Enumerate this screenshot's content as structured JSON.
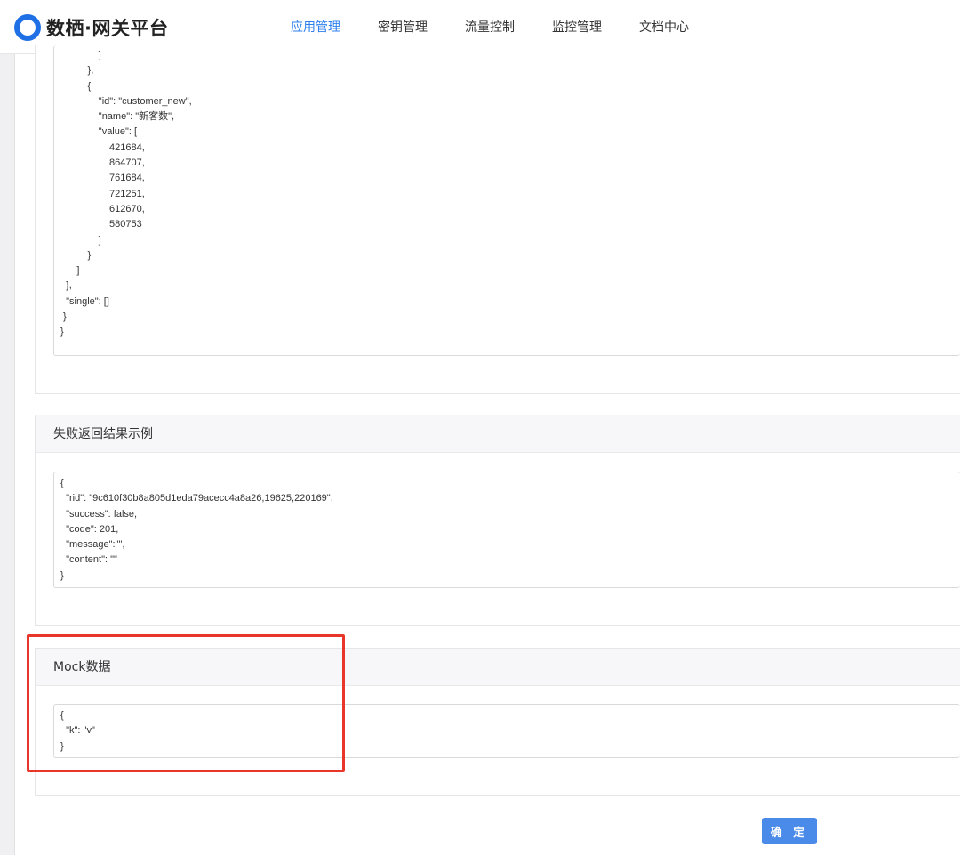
{
  "header": {
    "logo_text": "数栖·网关平台",
    "nav": [
      {
        "label": "应用管理",
        "active": true
      },
      {
        "label": "密钥管理",
        "active": false
      },
      {
        "label": "流量控制",
        "active": false
      },
      {
        "label": "监控管理",
        "active": false
      },
      {
        "label": "文档中心",
        "active": false
      }
    ]
  },
  "success_example": {
    "code": "              ]\n          },\n          {\n              \"id\": \"customer_new\",\n              \"name\": \"新客数\",\n              \"value\": [\n                  421684,\n                  864707,\n                  761684,\n                  721251,\n                  612670,\n                  580753\n              ]\n          }\n      ]\n  },\n  \"single\": []\n }\n}"
  },
  "failure_example": {
    "title": "失败返回结果示例",
    "code": "{\n  \"rid\": \"9c610f30b8a805d1eda79acecc4a8a26,19625,220169\",\n  \"success\": false,\n  \"code\": 201,\n  \"message\":\"\",\n  \"content\": \"\"\n}"
  },
  "mock": {
    "title": "Mock数据",
    "code": "{\n  \"k\": \"v\"\n}"
  },
  "actions": {
    "confirm_label": "确 定"
  },
  "colors": {
    "accent": "#2f80ed",
    "button": "#4a8ae8",
    "highlight_box": "#e8372a"
  }
}
